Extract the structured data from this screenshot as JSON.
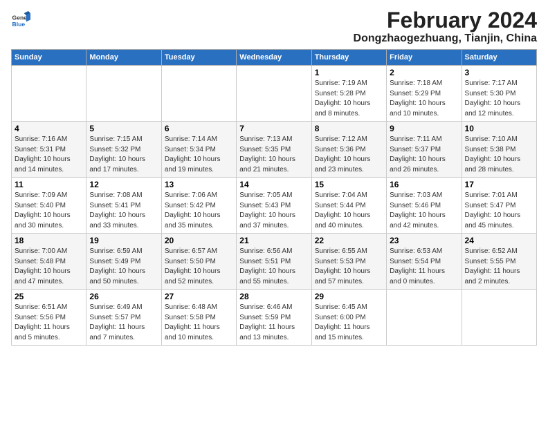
{
  "header": {
    "logo_line1": "General",
    "logo_line2": "Blue",
    "title": "February 2024",
    "subtitle": "Dongzhaogezhuang, Tianjin, China"
  },
  "weekdays": [
    "Sunday",
    "Monday",
    "Tuesday",
    "Wednesday",
    "Thursday",
    "Friday",
    "Saturday"
  ],
  "weeks": [
    [
      {
        "day": "",
        "info": ""
      },
      {
        "day": "",
        "info": ""
      },
      {
        "day": "",
        "info": ""
      },
      {
        "day": "",
        "info": ""
      },
      {
        "day": "1",
        "info": "Sunrise: 7:19 AM\nSunset: 5:28 PM\nDaylight: 10 hours\nand 8 minutes."
      },
      {
        "day": "2",
        "info": "Sunrise: 7:18 AM\nSunset: 5:29 PM\nDaylight: 10 hours\nand 10 minutes."
      },
      {
        "day": "3",
        "info": "Sunrise: 7:17 AM\nSunset: 5:30 PM\nDaylight: 10 hours\nand 12 minutes."
      }
    ],
    [
      {
        "day": "4",
        "info": "Sunrise: 7:16 AM\nSunset: 5:31 PM\nDaylight: 10 hours\nand 14 minutes."
      },
      {
        "day": "5",
        "info": "Sunrise: 7:15 AM\nSunset: 5:32 PM\nDaylight: 10 hours\nand 17 minutes."
      },
      {
        "day": "6",
        "info": "Sunrise: 7:14 AM\nSunset: 5:34 PM\nDaylight: 10 hours\nand 19 minutes."
      },
      {
        "day": "7",
        "info": "Sunrise: 7:13 AM\nSunset: 5:35 PM\nDaylight: 10 hours\nand 21 minutes."
      },
      {
        "day": "8",
        "info": "Sunrise: 7:12 AM\nSunset: 5:36 PM\nDaylight: 10 hours\nand 23 minutes."
      },
      {
        "day": "9",
        "info": "Sunrise: 7:11 AM\nSunset: 5:37 PM\nDaylight: 10 hours\nand 26 minutes."
      },
      {
        "day": "10",
        "info": "Sunrise: 7:10 AM\nSunset: 5:38 PM\nDaylight: 10 hours\nand 28 minutes."
      }
    ],
    [
      {
        "day": "11",
        "info": "Sunrise: 7:09 AM\nSunset: 5:40 PM\nDaylight: 10 hours\nand 30 minutes."
      },
      {
        "day": "12",
        "info": "Sunrise: 7:08 AM\nSunset: 5:41 PM\nDaylight: 10 hours\nand 33 minutes."
      },
      {
        "day": "13",
        "info": "Sunrise: 7:06 AM\nSunset: 5:42 PM\nDaylight: 10 hours\nand 35 minutes."
      },
      {
        "day": "14",
        "info": "Sunrise: 7:05 AM\nSunset: 5:43 PM\nDaylight: 10 hours\nand 37 minutes."
      },
      {
        "day": "15",
        "info": "Sunrise: 7:04 AM\nSunset: 5:44 PM\nDaylight: 10 hours\nand 40 minutes."
      },
      {
        "day": "16",
        "info": "Sunrise: 7:03 AM\nSunset: 5:46 PM\nDaylight: 10 hours\nand 42 minutes."
      },
      {
        "day": "17",
        "info": "Sunrise: 7:01 AM\nSunset: 5:47 PM\nDaylight: 10 hours\nand 45 minutes."
      }
    ],
    [
      {
        "day": "18",
        "info": "Sunrise: 7:00 AM\nSunset: 5:48 PM\nDaylight: 10 hours\nand 47 minutes."
      },
      {
        "day": "19",
        "info": "Sunrise: 6:59 AM\nSunset: 5:49 PM\nDaylight: 10 hours\nand 50 minutes."
      },
      {
        "day": "20",
        "info": "Sunrise: 6:57 AM\nSunset: 5:50 PM\nDaylight: 10 hours\nand 52 minutes."
      },
      {
        "day": "21",
        "info": "Sunrise: 6:56 AM\nSunset: 5:51 PM\nDaylight: 10 hours\nand 55 minutes."
      },
      {
        "day": "22",
        "info": "Sunrise: 6:55 AM\nSunset: 5:53 PM\nDaylight: 10 hours\nand 57 minutes."
      },
      {
        "day": "23",
        "info": "Sunrise: 6:53 AM\nSunset: 5:54 PM\nDaylight: 11 hours\nand 0 minutes."
      },
      {
        "day": "24",
        "info": "Sunrise: 6:52 AM\nSunset: 5:55 PM\nDaylight: 11 hours\nand 2 minutes."
      }
    ],
    [
      {
        "day": "25",
        "info": "Sunrise: 6:51 AM\nSunset: 5:56 PM\nDaylight: 11 hours\nand 5 minutes."
      },
      {
        "day": "26",
        "info": "Sunrise: 6:49 AM\nSunset: 5:57 PM\nDaylight: 11 hours\nand 7 minutes."
      },
      {
        "day": "27",
        "info": "Sunrise: 6:48 AM\nSunset: 5:58 PM\nDaylight: 11 hours\nand 10 minutes."
      },
      {
        "day": "28",
        "info": "Sunrise: 6:46 AM\nSunset: 5:59 PM\nDaylight: 11 hours\nand 13 minutes."
      },
      {
        "day": "29",
        "info": "Sunrise: 6:45 AM\nSunset: 6:00 PM\nDaylight: 11 hours\nand 15 minutes."
      },
      {
        "day": "",
        "info": ""
      },
      {
        "day": "",
        "info": ""
      }
    ]
  ]
}
